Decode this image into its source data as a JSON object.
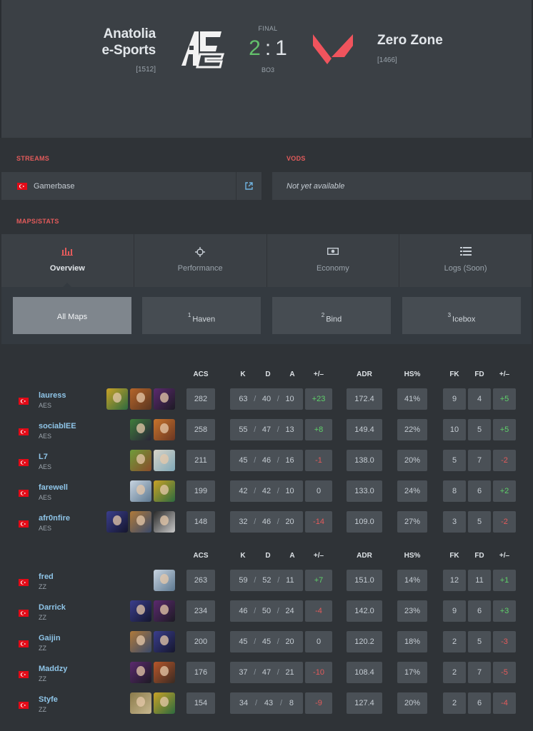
{
  "match": {
    "team1": {
      "name_line1": "Anatolia",
      "name_line2": "e-Sports",
      "rating": "[1512]"
    },
    "team2": {
      "name": "Zero Zone",
      "rating": "[1466]"
    },
    "status": "FINAL",
    "score1": "2",
    "score_sep": ":",
    "score2": "1",
    "format": "BO3"
  },
  "streams": {
    "label": "STREAMS",
    "items": [
      {
        "name": "Gamerbase"
      }
    ]
  },
  "vods": {
    "label": "VODS",
    "text": "Not yet available"
  },
  "maps_stats_label": "MAPS/STATS",
  "tabs": [
    {
      "label": "Overview",
      "icon": "bar-chart-icon",
      "active": true
    },
    {
      "label": "Performance",
      "icon": "crosshair-icon",
      "active": false
    },
    {
      "label": "Economy",
      "icon": "money-icon",
      "active": false
    },
    {
      "label": "Logs (Soon)",
      "icon": "list-icon",
      "active": false
    }
  ],
  "maps": [
    {
      "num": "",
      "name": "All Maps",
      "active": true
    },
    {
      "num": "1",
      "name": "Haven",
      "active": false
    },
    {
      "num": "2",
      "name": "Bind",
      "active": false
    },
    {
      "num": "3",
      "name": "Icebox",
      "active": false
    }
  ],
  "columns": {
    "acs": "ACS",
    "k": "K",
    "d": "D",
    "a": "A",
    "pm": "+/–",
    "adr": "ADR",
    "hs": "HS%",
    "fk": "FK",
    "fd": "FD",
    "fpm": "+/–"
  },
  "teams": [
    {
      "tag": "AES",
      "players": [
        {
          "name": "lauress",
          "team": "AES",
          "agents": [
            "killjoy",
            "breach",
            "reyna"
          ],
          "acs": "282",
          "k": "63",
          "d": "40",
          "a": "10",
          "pm": "+23",
          "adr": "172.4",
          "hs": "41%",
          "fk": "9",
          "fd": "4",
          "fpm": "+5"
        },
        {
          "name": "sociablEE",
          "team": "AES",
          "agents": [
            "viper",
            "phoenix"
          ],
          "acs": "258",
          "k": "55",
          "d": "47",
          "a": "13",
          "pm": "+8",
          "adr": "149.4",
          "hs": "22%",
          "fk": "10",
          "fd": "5",
          "fpm": "+5"
        },
        {
          "name": "L7",
          "team": "AES",
          "agents": [
            "skye",
            "sage"
          ],
          "acs": "211",
          "k": "45",
          "d": "46",
          "a": "16",
          "pm": "-1",
          "adr": "138.0",
          "hs": "20%",
          "fk": "5",
          "fd": "7",
          "fpm": "-2"
        },
        {
          "name": "farewell",
          "team": "AES",
          "agents": [
            "jett",
            "killjoy"
          ],
          "acs": "199",
          "k": "42",
          "d": "42",
          "a": "10",
          "pm": "0",
          "adr": "133.0",
          "hs": "24%",
          "fk": "8",
          "fd": "6",
          "fpm": "+2"
        },
        {
          "name": "afr0nfire",
          "team": "AES",
          "agents": [
            "omen",
            "sova",
            "cypher"
          ],
          "acs": "148",
          "k": "32",
          "d": "46",
          "a": "20",
          "pm": "-14",
          "adr": "109.0",
          "hs": "27%",
          "fk": "3",
          "fd": "5",
          "fpm": "-2"
        }
      ]
    },
    {
      "tag": "ZZ",
      "players": [
        {
          "name": "fred",
          "team": "ZZ",
          "agents": [
            "jett"
          ],
          "acs": "263",
          "k": "59",
          "d": "52",
          "a": "11",
          "pm": "+7",
          "adr": "151.0",
          "hs": "14%",
          "fk": "12",
          "fd": "11",
          "fpm": "+1"
        },
        {
          "name": "Darrick",
          "team": "ZZ",
          "agents": [
            "omen",
            "reyna"
          ],
          "acs": "234",
          "k": "46",
          "d": "50",
          "a": "24",
          "pm": "-4",
          "adr": "142.0",
          "hs": "23%",
          "fk": "9",
          "fd": "6",
          "fpm": "+3"
        },
        {
          "name": "Gaijin",
          "team": "ZZ",
          "agents": [
            "sova",
            "omen"
          ],
          "acs": "200",
          "k": "45",
          "d": "45",
          "a": "20",
          "pm": "0",
          "adr": "120.2",
          "hs": "18%",
          "fk": "2",
          "fd": "5",
          "fpm": "-3"
        },
        {
          "name": "Maddzy",
          "team": "ZZ",
          "agents": [
            "reyna",
            "raze"
          ],
          "acs": "176",
          "k": "37",
          "d": "47",
          "a": "21",
          "pm": "-10",
          "adr": "108.4",
          "hs": "17%",
          "fk": "2",
          "fd": "7",
          "fpm": "-5"
        },
        {
          "name": "Styfe",
          "team": "ZZ",
          "agents": [
            "brimstone",
            "killjoy"
          ],
          "acs": "154",
          "k": "34",
          "d": "43",
          "a": "8",
          "pm": "-9",
          "adr": "127.4",
          "hs": "20%",
          "fk": "2",
          "fd": "6",
          "fpm": "-4"
        }
      ]
    }
  ],
  "colors": {
    "accent": "#e35b5b",
    "positive": "#5fd16a",
    "negative": "#e35b5b",
    "link": "#8fc5e8"
  }
}
